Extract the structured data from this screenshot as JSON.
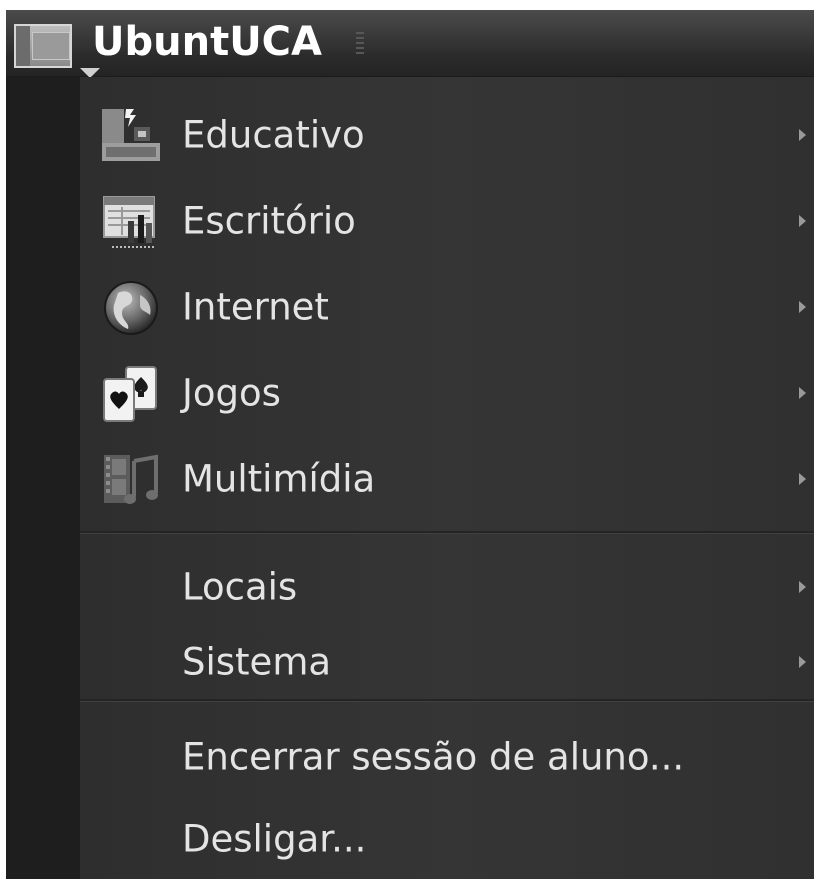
{
  "panel": {
    "title": "UbuntUCA"
  },
  "menu": {
    "categories": [
      {
        "label": "Educativo",
        "icon": "education-icon"
      },
      {
        "label": "Escritório",
        "icon": "office-icon"
      },
      {
        "label": "Internet",
        "icon": "globe-icon"
      },
      {
        "label": "Jogos",
        "icon": "playing-cards-icon"
      },
      {
        "label": "Multimídia",
        "icon": "multimedia-icon"
      }
    ],
    "places": [
      {
        "label": "Locais"
      },
      {
        "label": "Sistema"
      }
    ],
    "actions": [
      {
        "label": "Encerrar sessão de aluno..."
      },
      {
        "label": "Desligar..."
      }
    ]
  }
}
